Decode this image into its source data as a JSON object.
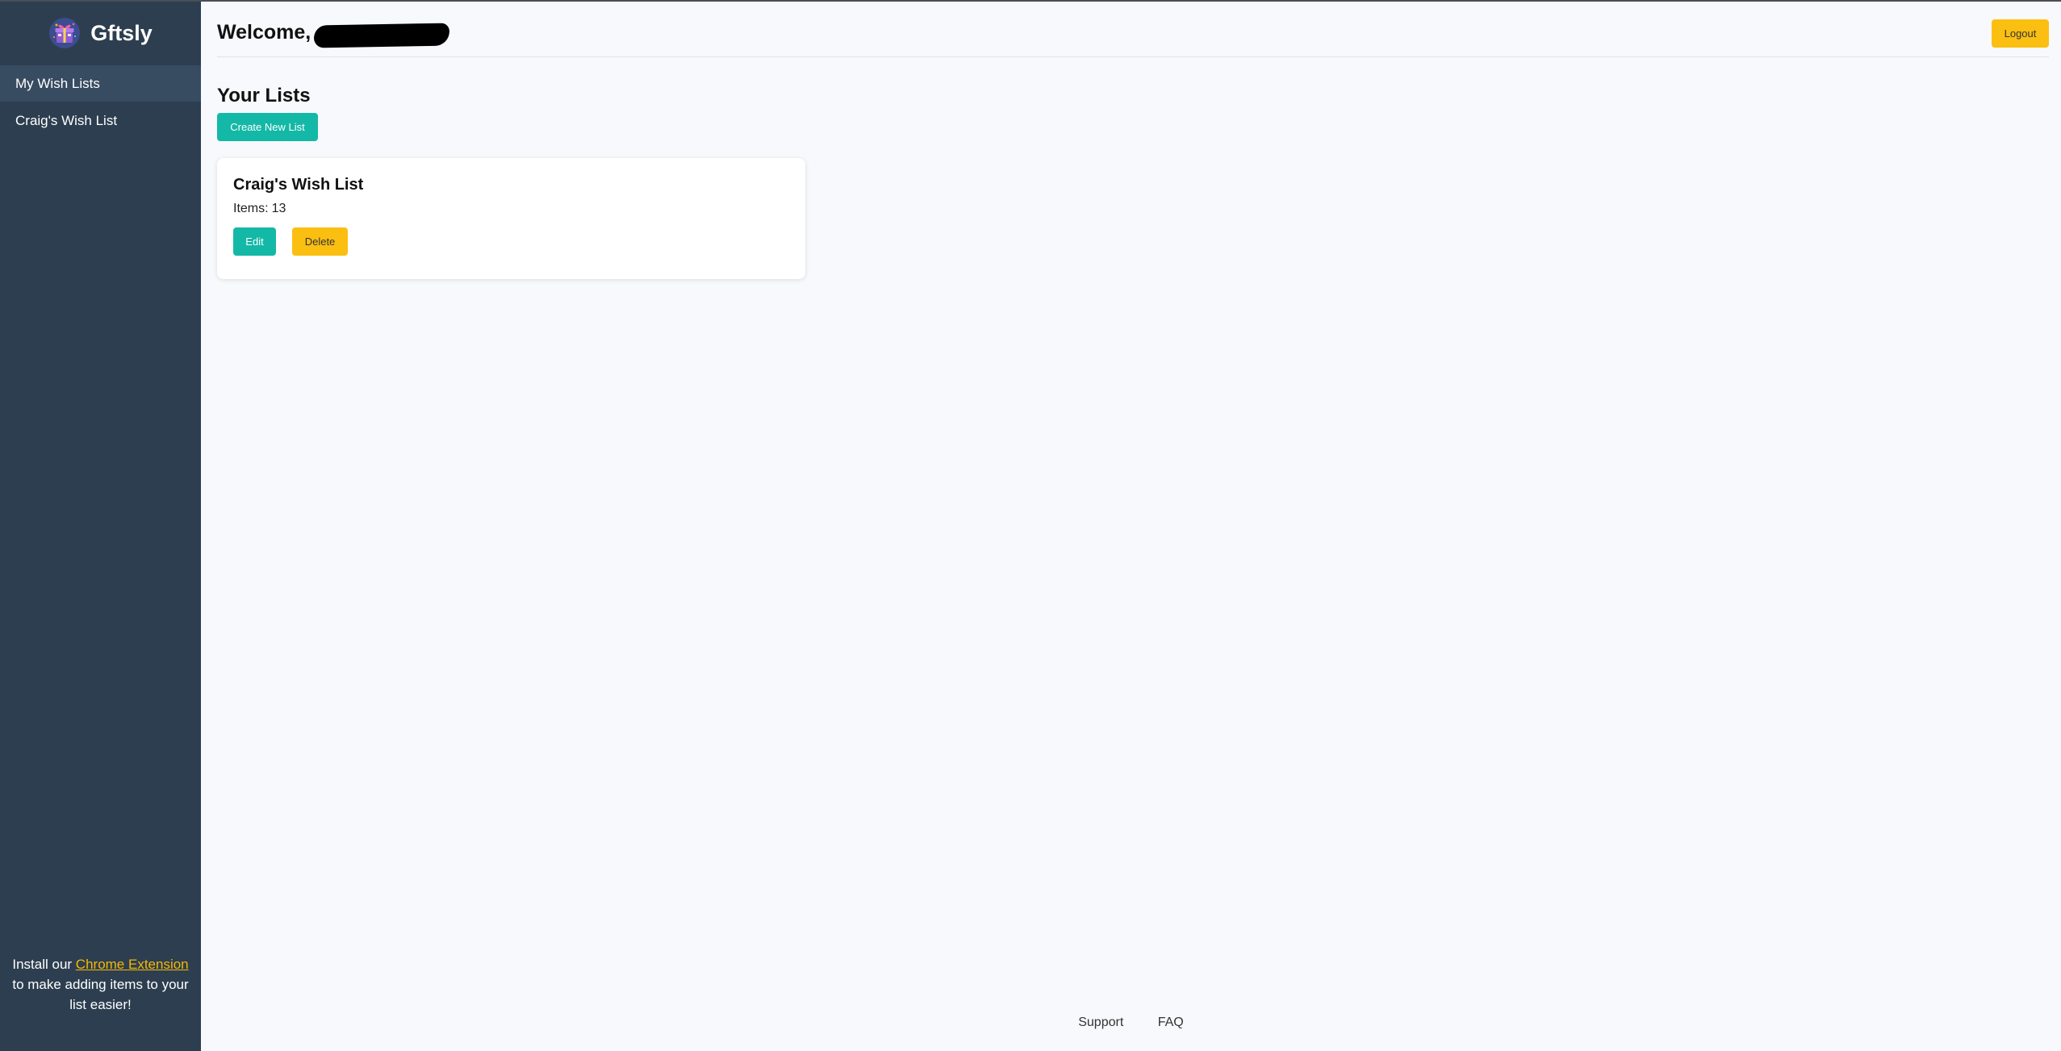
{
  "app": {
    "brand_name": "Gftsly",
    "logo_icon": "gift-box-logo-icon"
  },
  "sidebar": {
    "items": [
      {
        "label": "My Wish Lists",
        "active": true
      },
      {
        "label": "Craig's Wish List",
        "active": false
      }
    ],
    "promo": {
      "prefix": "Install our",
      "link_text": "Chrome Extension",
      "suffix": "to make adding items to your list easier!"
    }
  },
  "header": {
    "welcome_text": "Welcome,",
    "logout_label": "Logout"
  },
  "main": {
    "section_title": "Your Lists",
    "create_button_label": "Create New List",
    "lists": [
      {
        "title": "Craig's Wish List",
        "items_label": "Items:",
        "items_count": "13",
        "edit_label": "Edit",
        "delete_label": "Delete"
      }
    ]
  },
  "footer": {
    "links": [
      "Support",
      "FAQ"
    ]
  },
  "colors": {
    "sidebar_bg": "#2d3e50",
    "sidebar_active": "#374b61",
    "primary_teal": "#14b8a6",
    "accent_amber": "#fbbf11",
    "page_bg": "#f7f9fc"
  }
}
